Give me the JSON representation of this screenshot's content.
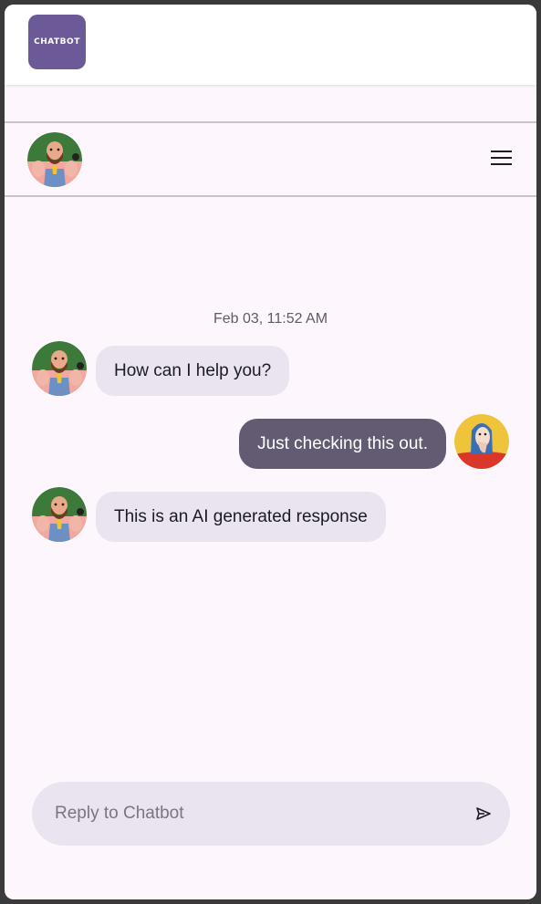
{
  "app": {
    "logo_text": "CHATBOT"
  },
  "chat": {
    "timestamp": "Feb 03, 11:52 AM",
    "messages": [
      {
        "sender": "bot",
        "text": "How can I help you?"
      },
      {
        "sender": "user",
        "text": "Just checking this out."
      },
      {
        "sender": "bot",
        "text": "This is an AI generated response"
      }
    ]
  },
  "composer": {
    "placeholder": "Reply to Chatbot"
  },
  "icons": {
    "menu": "hamburger-menu-icon",
    "send": "send-icon",
    "bot_avatar": "bot-avatar-icon",
    "user_avatar": "user-avatar-icon"
  },
  "colors": {
    "brand": "#6b5a97",
    "user_bubble": "#625b71",
    "bot_bubble": "#e9e4ef",
    "background": "#fdf7fd"
  }
}
